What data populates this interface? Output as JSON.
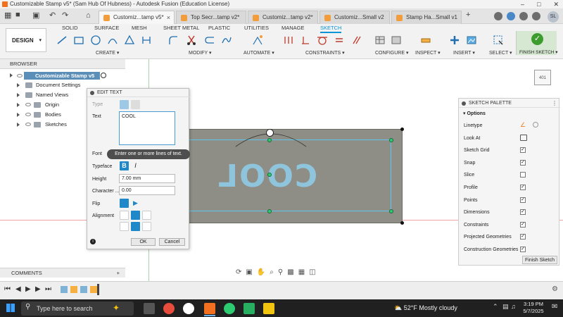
{
  "window": {
    "title": "Customizable Stamp v5* (Sam Hub Of Hubness) - Autodesk Fusion (Education License)",
    "controls": [
      "–",
      "□",
      "✕"
    ]
  },
  "tabs": [
    {
      "label": "Customiz...tamp v5*",
      "active": true
    },
    {
      "label": "Top Secr...tamp v2*",
      "active": false
    },
    {
      "label": "Customiz...tamp v2*",
      "active": false
    },
    {
      "label": "Customiz...Small v2",
      "active": false
    },
    {
      "label": "Stamp Ha...Small v1",
      "active": false
    }
  ],
  "user": {
    "initials": "SL"
  },
  "ribbon": {
    "workspace": "DESIGN",
    "workspace_tabs": [
      "SOLID",
      "SURFACE",
      "MESH",
      "SHEET METAL",
      "PLASTIC",
      "UTILITIES",
      "MANAGE",
      "SKETCH"
    ],
    "active_tab": "SKETCH",
    "groups": [
      "CREATE",
      "MODIFY",
      "AUTOMATE",
      "CONSTRAINTS",
      "CONFIGURE",
      "INSPECT",
      "INSERT",
      "SELECT",
      "FINISH SKETCH"
    ]
  },
  "browser": {
    "title": "BROWSER",
    "root": "Customizable Stamp v5",
    "items": [
      "Document Settings",
      "Named Views",
      "Origin",
      "Bodies",
      "Sketches"
    ]
  },
  "edit_text": {
    "title": "EDIT TEXT",
    "type_label": "Type",
    "text_label": "Text",
    "text_value": "COOL",
    "font_label": "Font",
    "tooltip": "Enter one or more lines of text.",
    "typeface_label": "Typeface",
    "height_label": "Height",
    "height_value": "7.00 mm",
    "spacing_label": "Character ...",
    "spacing_value": "0.00",
    "flip_label": "Flip",
    "alignment_label": "Alignment",
    "ok": "OK",
    "cancel": "Cancel",
    "bold_glyph": "B",
    "italic_glyph": "I"
  },
  "canvas": {
    "sketch_text": "COOL",
    "viewcube_label": "401"
  },
  "palette": {
    "title": "SKETCH PALETTE",
    "section": "Options",
    "rows": [
      {
        "label": "Linetype",
        "checked": null
      },
      {
        "label": "Look At",
        "checked": null
      },
      {
        "label": "Sketch Grid",
        "checked": true
      },
      {
        "label": "Snap",
        "checked": true
      },
      {
        "label": "Slice",
        "checked": false
      },
      {
        "label": "Profile",
        "checked": true
      },
      {
        "label": "Points",
        "checked": true
      },
      {
        "label": "Dimensions",
        "checked": true
      },
      {
        "label": "Constraints",
        "checked": true
      },
      {
        "label": "Projected Geometries",
        "checked": true
      },
      {
        "label": "Construction Geometries",
        "checked": true
      }
    ],
    "finish_button": "Finish Sketch"
  },
  "comments": {
    "label": "COMMENTS"
  },
  "taskbar": {
    "search_placeholder": "Type here to search",
    "weather_temp": "52°F",
    "weather_text": "Mostly cloudy",
    "time": "3:19 PM",
    "date": "5/7/2025"
  },
  "colors": {
    "accent": "#0696d7",
    "selection": "#5ec6ee",
    "finish": "#3c9c2e"
  }
}
